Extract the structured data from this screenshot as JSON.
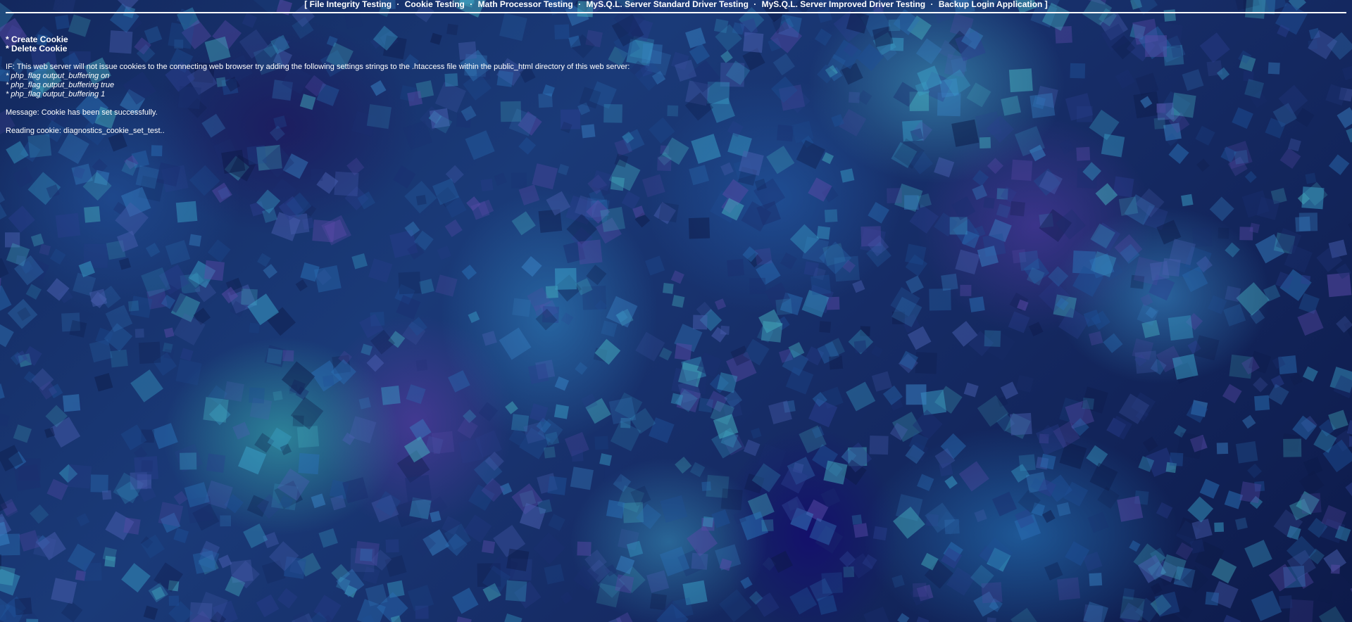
{
  "nav": {
    "open_bracket": "[",
    "close_bracket": "]",
    "separator": "·",
    "items": [
      "File Integrity Testing",
      "Cookie Testing",
      "Math Processor Testing",
      "MyS.Q.L. Server Standard Driver Testing",
      "MyS.Q.L. Server Improved Driver Testing",
      "Backup Login Application"
    ]
  },
  "actions": {
    "create": "* Create Cookie",
    "delete": "* Delete Cookie"
  },
  "notice": {
    "intro": "IF: This web server will not issue cookies to the connecting web browser try adding the following settings strings to the .htaccess file within the public_html directory of this web server:",
    "settings": [
      "* php_flag output_buffering on",
      "* php_flag output_buffering true",
      "* php_flag output_buffering 1"
    ]
  },
  "message": "Message: Cookie has been set successfully.",
  "reading": "Reading cookie: diagnostics_cookie_set_test..",
  "colors": {
    "text": "#ffffff",
    "background_base": "#13285e"
  }
}
